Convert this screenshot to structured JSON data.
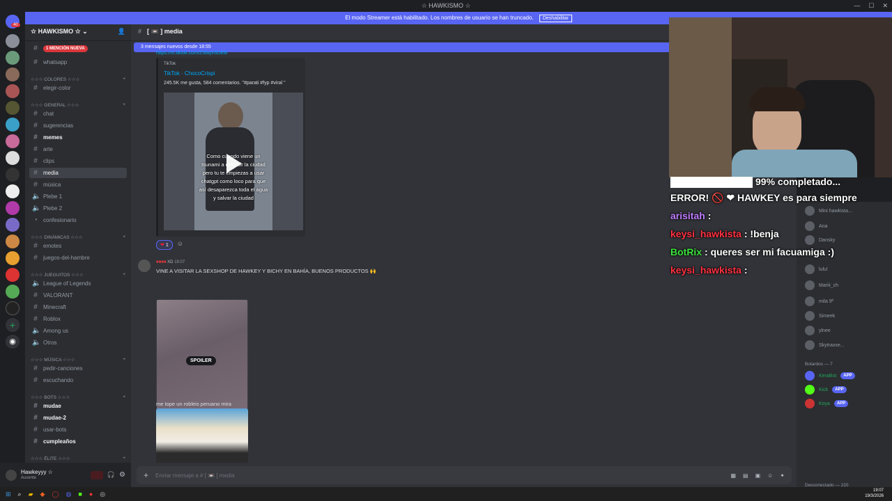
{
  "window": {
    "title": "☆ HAWKISMO ☆",
    "controls": [
      "—",
      "☐",
      "✕"
    ]
  },
  "banner": {
    "text": "El modo Streamer está habilitado. Los nombres de usuario se han truncado.",
    "button": "Deshabilitar"
  },
  "servers": {
    "badge": "40"
  },
  "server_header": {
    "name": "☆ HAWKISMO ☆",
    "chevron": "⌄"
  },
  "sidebar": {
    "top_items": [
      {
        "label": "1 MENCIÓN NUEVA"
      },
      {
        "label": "whatsapp"
      }
    ],
    "categories": {
      "colores": "☆☆☆ COLORES ☆☆☆",
      "general": "☆☆☆ GENERAL ☆☆☆",
      "dinamicas": "☆☆☆ DINÁMICAS ☆☆☆",
      "juegos": "☆☆☆ JUEGUITOS ☆☆☆",
      "musica": "☆☆☆ MÚSICA ☆☆☆",
      "bots": "☆☆☆ BOTS ☆☆☆",
      "elite": "☆☆☆ ÉLITE ☆☆☆"
    },
    "channels": {
      "elegir_color": "elegir-color",
      "chat": "chat",
      "sugerencias": "sugerencias",
      "memes": "memes",
      "arte": "arte",
      "clips": "clips",
      "media": "media",
      "musica": "música",
      "plebe1": "Plebe 1",
      "plebe2": "Plebe 2",
      "confesionario": "confesionario",
      "emotes": "emotes",
      "juegos_hambre": "juegos-del-hambre",
      "lol": "League of Legends",
      "valorant": "VALORANT",
      "minecraft": "Minecraft",
      "roblox": "Roblox",
      "among": "Among us",
      "otros": "Otros",
      "pedir": "pedir-canciones",
      "escuchando": "escuchando",
      "mudae": "mudae",
      "mudae2": "mudae-2",
      "usarbots": "usar-bots",
      "cumples": "cumpleaños"
    }
  },
  "user_panel": {
    "name": "Hawkeyyy ☆",
    "status": "Ausente"
  },
  "channel_header": {
    "hash": "#",
    "name": "[ 📼 ] media"
  },
  "new_messages": {
    "text": "3 mensajes nuevos desde 18:55"
  },
  "embed": {
    "link": "https://vt.tiktok.com/ZS6qV6DE8/",
    "provider": "TikTok",
    "title": "TikTok · ChocoCrispi",
    "description": "245.5K me gusta, 584 comentarios. \"#parati #fyp #viral \"",
    "caption": "Como cuando viene un tsunami a destruir la ciudad pero tu te empiezas a usar chatgpt como loco para que así desaparezca toda el agua y salvar la ciudad"
  },
  "reactions": [
    {
      "emoji": "❤",
      "count": "1"
    }
  ],
  "message2": {
    "author": "XD",
    "time": "19:07",
    "text": "VINE A VISITAR LA SEXSHOP DE HAWKEY Y BICHY EN BAHÍA, BUENOS PRODUCTOS 🙌",
    "spoiler": "SPOILER"
  },
  "message3": {
    "text": "me tope un robleis peruano mira"
  },
  "composer": {
    "placeholder": "Enviar mensaje a #   [ 📼 ]  media"
  },
  "stream_overlay": {
    "progress": "99% completado...",
    "error": "ERROR! 🚫 ❤ HAWKEY es para siempre",
    "chat": [
      {
        "user": "arisitah",
        "text": ":"
      },
      {
        "user": "keysi_hawkista",
        "text": ": !benja"
      },
      {
        "user": "BotRix",
        "text": "queres ser mi facuamiga :)"
      },
      {
        "user": "keysi_hawkista",
        "text": ":"
      }
    ]
  },
  "members": {
    "list": [
      "Mini hawkista...",
      "Ana",
      "Dansky",
      "lulu!",
      "Mariii_ch",
      "mila 9º",
      "Simeek",
      "ylnee",
      "Skytraxxe..."
    ],
    "bots_heading": "Botardos — 7",
    "bots": [
      "KeraBot",
      "Kick",
      "Koya"
    ],
    "bot_tag": "APP",
    "offline_heading": "Desconectado — 220"
  },
  "taskbar": {
    "lang": "ESP\nLAA",
    "time": "19:07",
    "date": "19/3/2026"
  }
}
